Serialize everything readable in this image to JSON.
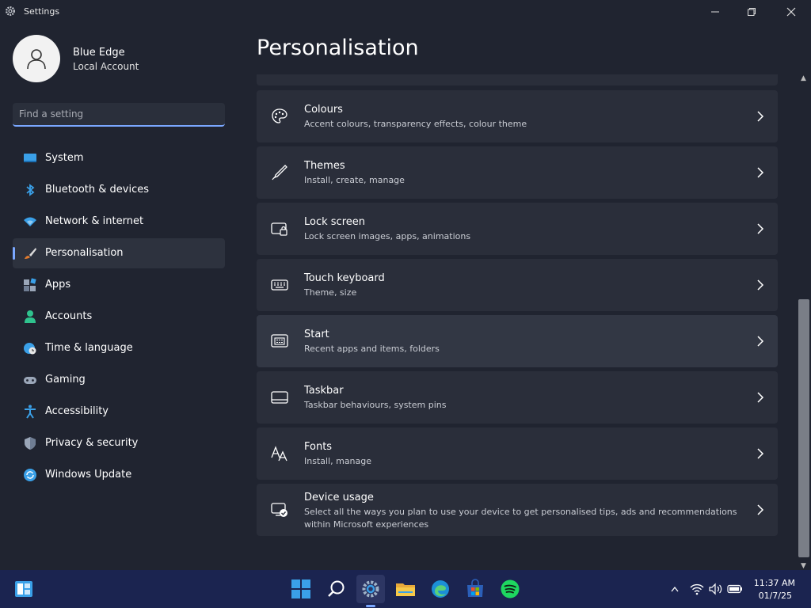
{
  "window": {
    "title": "Settings"
  },
  "profile": {
    "name": "Blue Edge",
    "account_type": "Local Account"
  },
  "search": {
    "placeholder": "Find a setting"
  },
  "sidebar": {
    "items": [
      {
        "label": "System",
        "icon": "monitor-icon"
      },
      {
        "label": "Bluetooth & devices",
        "icon": "bluetooth-icon"
      },
      {
        "label": "Network & internet",
        "icon": "wifi-icon"
      },
      {
        "label": "Personalisation",
        "icon": "brush-icon",
        "active": true
      },
      {
        "label": "Apps",
        "icon": "apps-icon"
      },
      {
        "label": "Accounts",
        "icon": "person-icon"
      },
      {
        "label": "Time & language",
        "icon": "globe-clock-icon"
      },
      {
        "label": "Gaming",
        "icon": "gamepad-icon"
      },
      {
        "label": "Accessibility",
        "icon": "accessibility-icon"
      },
      {
        "label": "Privacy & security",
        "icon": "shield-icon"
      },
      {
        "label": "Windows Update",
        "icon": "update-icon"
      }
    ]
  },
  "main": {
    "title": "Personalisation",
    "cards": [
      {
        "title": "Colours",
        "subtitle": "Accent colours, transparency effects, colour theme",
        "icon": "palette-icon"
      },
      {
        "title": "Themes",
        "subtitle": "Install, create, manage",
        "icon": "pen-icon"
      },
      {
        "title": "Lock screen",
        "subtitle": "Lock screen images, apps, animations",
        "icon": "lock-screen-icon"
      },
      {
        "title": "Touch keyboard",
        "subtitle": "Theme, size",
        "icon": "keyboard-icon"
      },
      {
        "title": "Start",
        "subtitle": "Recent apps and items, folders",
        "icon": "start-icon"
      },
      {
        "title": "Taskbar",
        "subtitle": "Taskbar behaviours, system pins",
        "icon": "taskbar-icon"
      },
      {
        "title": "Fonts",
        "subtitle": "Install, manage",
        "icon": "fonts-icon"
      },
      {
        "title": "Device usage",
        "subtitle": "Select all the ways you plan to use your device to get personalised tips, ads and recommendations within Microsoft experiences",
        "icon": "device-usage-icon"
      }
    ]
  },
  "taskbar": {
    "apps": [
      "widgets-icon",
      "windows-start-icon",
      "search-icon",
      "settings-icon",
      "file-explorer-icon",
      "edge-icon",
      "store-icon",
      "spotify-icon"
    ],
    "time": "11:37 AM",
    "date": "01/7/25"
  },
  "colors": {
    "accent": "#7aa7ff",
    "background": "#202430",
    "card": "#2a2e3a",
    "taskbar": "#1b2450"
  }
}
